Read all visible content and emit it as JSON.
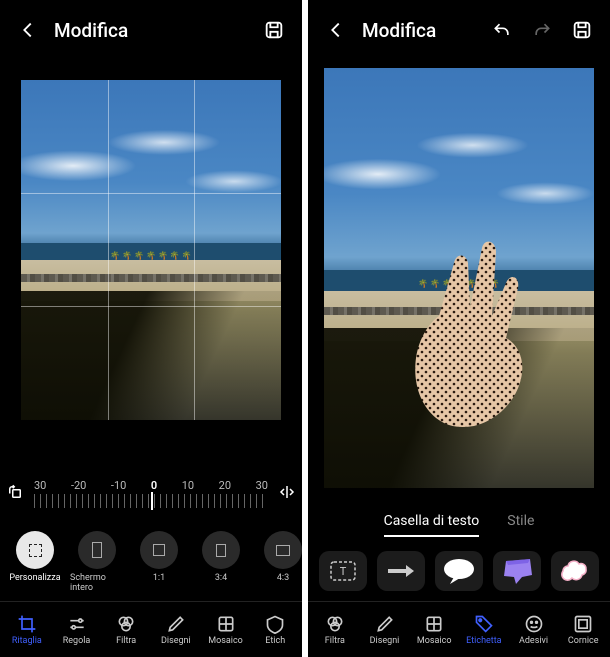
{
  "left": {
    "title": "Modifica",
    "rotate_ticks": [
      "30",
      "-20",
      "-10",
      "0",
      "10",
      "20",
      "30"
    ],
    "aspect_chips": [
      {
        "id": "custom",
        "label": "Personalizza",
        "w": 13,
        "h": 13,
        "selected": true
      },
      {
        "id": "fullscreen",
        "label": "Schermo intero",
        "w": 10,
        "h": 16
      },
      {
        "id": "1_1",
        "label": "1:1",
        "w": 12,
        "h": 12
      },
      {
        "id": "3_4",
        "label": "3:4",
        "w": 10,
        "h": 13
      },
      {
        "id": "4_3",
        "label": "4:3",
        "w": 14,
        "h": 11
      }
    ],
    "tabs": [
      {
        "id": "crop",
        "label": "Ritaglia",
        "active": true
      },
      {
        "id": "adjust",
        "label": "Regola"
      },
      {
        "id": "filter",
        "label": "Filtra"
      },
      {
        "id": "draw",
        "label": "Disegni"
      },
      {
        "id": "mosaic",
        "label": "Mosaico"
      },
      {
        "id": "label",
        "label": "Etich"
      }
    ]
  },
  "right": {
    "title": "Modifica",
    "subtabs": [
      {
        "id": "textbox",
        "label": "Casella di testo",
        "active": true
      },
      {
        "id": "style",
        "label": "Stile"
      }
    ],
    "palette": [
      {
        "id": "text-outline"
      },
      {
        "id": "arrow"
      },
      {
        "id": "bubble-white"
      },
      {
        "id": "bubble-purple"
      },
      {
        "id": "bubble-cloud"
      }
    ],
    "tabs": [
      {
        "id": "filter",
        "label": "Filtra"
      },
      {
        "id": "draw",
        "label": "Disegni"
      },
      {
        "id": "mosaic",
        "label": "Mosaico"
      },
      {
        "id": "label",
        "label": "Etichetta",
        "active": true
      },
      {
        "id": "sticker",
        "label": "Adesivi"
      },
      {
        "id": "frame",
        "label": "Cornice"
      }
    ]
  }
}
